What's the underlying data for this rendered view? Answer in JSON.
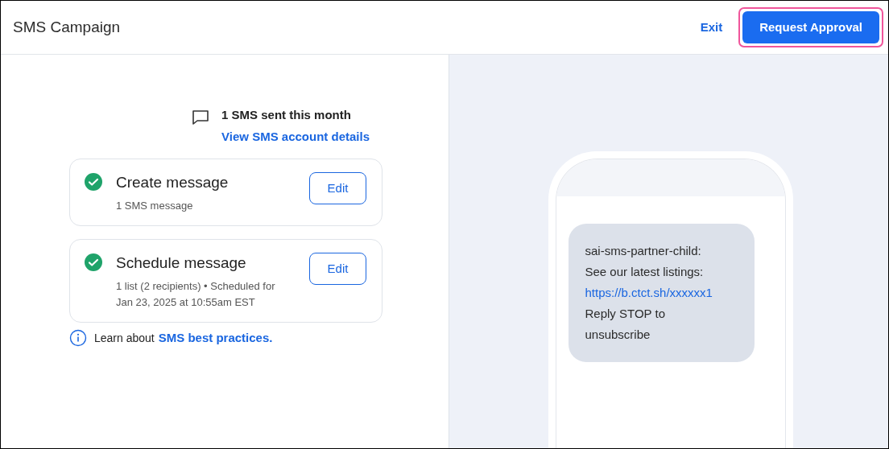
{
  "header": {
    "title": "SMS Campaign",
    "exit": "Exit",
    "request_button": {
      "label": "Request Approval",
      "highlighted": true
    }
  },
  "usage": {
    "count_text": "1 SMS sent this month",
    "link": "View SMS account details"
  },
  "steps": [
    {
      "title": "Create message",
      "details": [
        "1 SMS message"
      ],
      "completed": true,
      "button": "Edit"
    },
    {
      "title": "Schedule message",
      "details": [
        "1 list (2 recipients) • Scheduled for",
        "Jan 23, 2025 at 10:55am EST"
      ],
      "completed": true,
      "button": "Edit"
    }
  ],
  "tip": {
    "text": "Learn about",
    "link": "SMS best practices."
  },
  "preview": {
    "message": [
      {
        "kind": "text",
        "text": "sai-sms-partner-child:"
      },
      {
        "kind": "text",
        "text": "See our latest listings:"
      },
      {
        "kind": "link",
        "text": "https://b.ctct.sh/xxxxxx1"
      },
      {
        "kind": "text",
        "text": "Reply STOP to unsubscribe"
      }
    ]
  }
}
